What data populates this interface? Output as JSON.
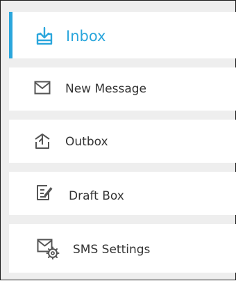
{
  "sidebar": {
    "accent_color": "#2aa6dc",
    "items": [
      {
        "label": "Inbox",
        "icon": "inbox-download-icon",
        "active": true
      },
      {
        "label": "New Message",
        "icon": "envelope-icon",
        "active": false
      },
      {
        "label": "Outbox",
        "icon": "outbox-upload-icon",
        "active": false
      },
      {
        "label": "Draft Box",
        "icon": "draft-edit-icon",
        "active": false
      },
      {
        "label": "SMS Settings",
        "icon": "message-settings-icon",
        "active": false
      }
    ]
  }
}
